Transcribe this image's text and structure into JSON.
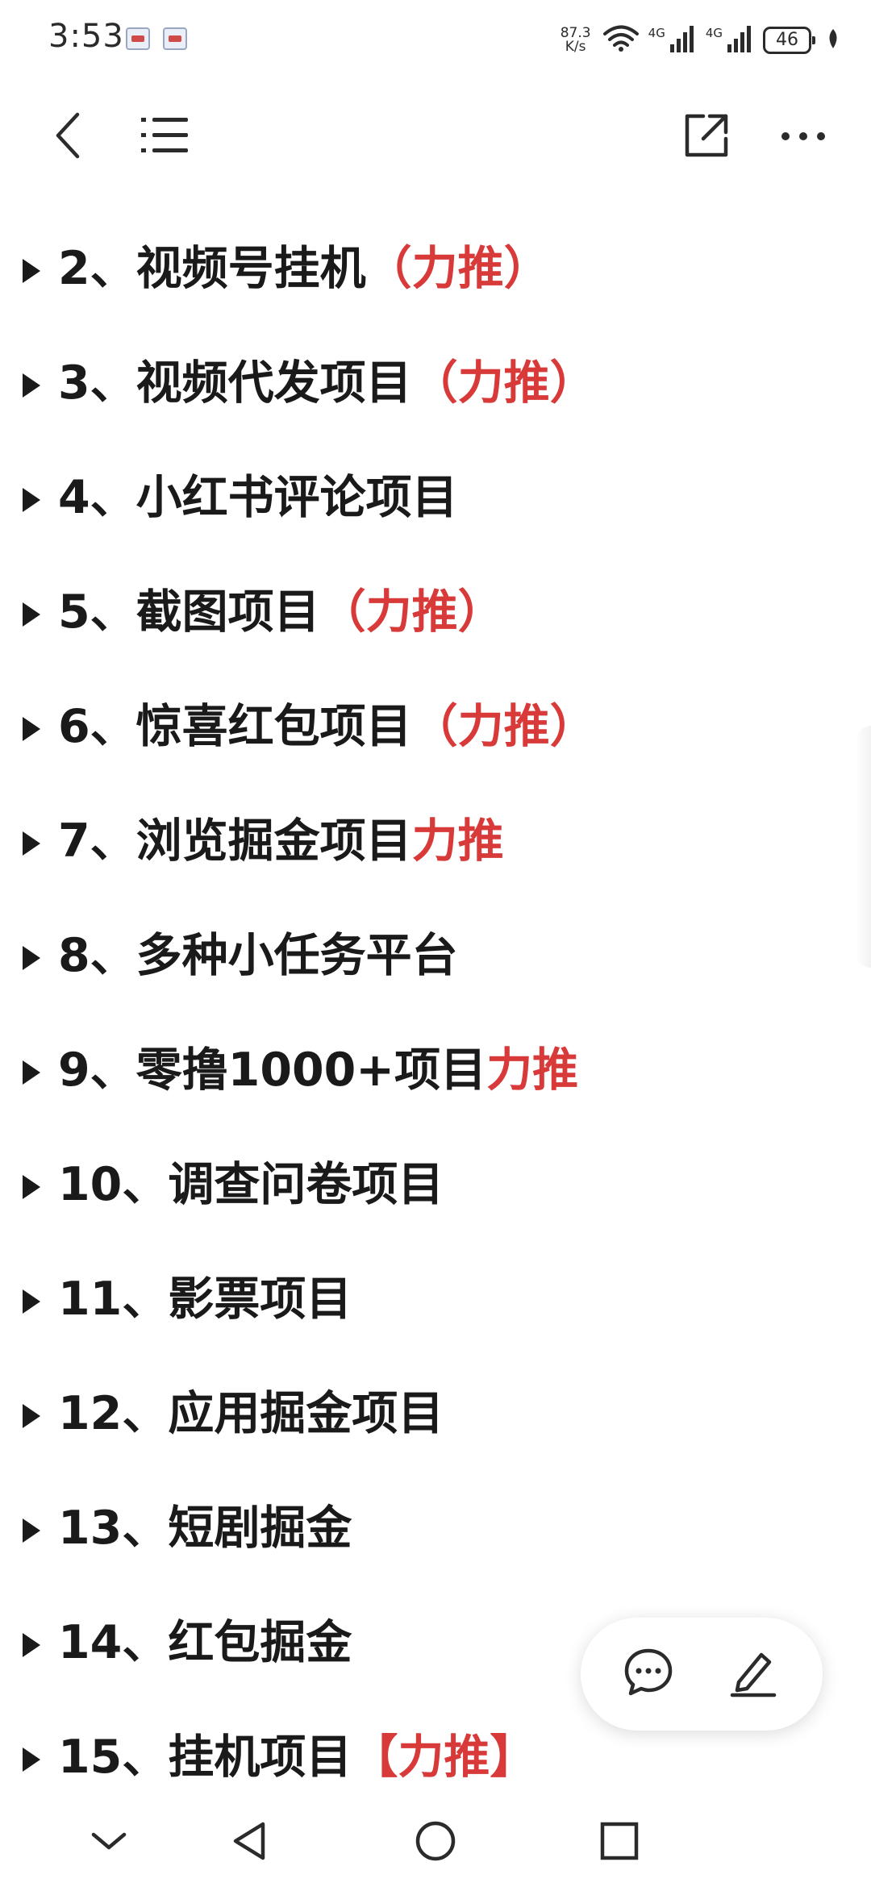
{
  "status_bar": {
    "time": "3:53",
    "net_speed_value": "87.3",
    "net_speed_unit": "K/s",
    "signal_1_label": "4G",
    "signal_2_label": "4G",
    "battery": "46"
  },
  "top_nav": {
    "back_icon": "chevron-left-icon",
    "outline_icon": "list-icon",
    "share_icon": "external-link-icon",
    "more_icon": "more-horizontal-icon"
  },
  "outline": {
    "items": [
      {
        "text": "2、视频号挂机",
        "highlight": "（力推）"
      },
      {
        "text": "3、视频代发项目",
        "highlight": "（力推）"
      },
      {
        "text": "4、小红书评论项目",
        "highlight": ""
      },
      {
        "text": "5、截图项目",
        "highlight": "（力推）"
      },
      {
        "text": "6、惊喜红包项目",
        "highlight": "（力推）"
      },
      {
        "text": "7、浏览掘金项目",
        "highlight": "力推"
      },
      {
        "text": "8、多种小任务平台",
        "highlight": ""
      },
      {
        "text": "9、零撸1000+项目",
        "highlight": "力推"
      },
      {
        "text": "10、调查问卷项目",
        "highlight": ""
      },
      {
        "text": "11、影票项目",
        "highlight": ""
      },
      {
        "text": "12、应用掘金项目",
        "highlight": ""
      },
      {
        "text": "13、短剧掘金",
        "highlight": ""
      },
      {
        "text": "14、红包掘金",
        "highlight": ""
      },
      {
        "text": "15、挂机项目",
        "highlight": "【力推】"
      }
    ]
  },
  "float_panel": {
    "comment_icon": "comment-icon",
    "edit_icon": "pencil-icon"
  },
  "colors": {
    "highlight": "#d83a3a",
    "text": "#1a1a1a"
  }
}
